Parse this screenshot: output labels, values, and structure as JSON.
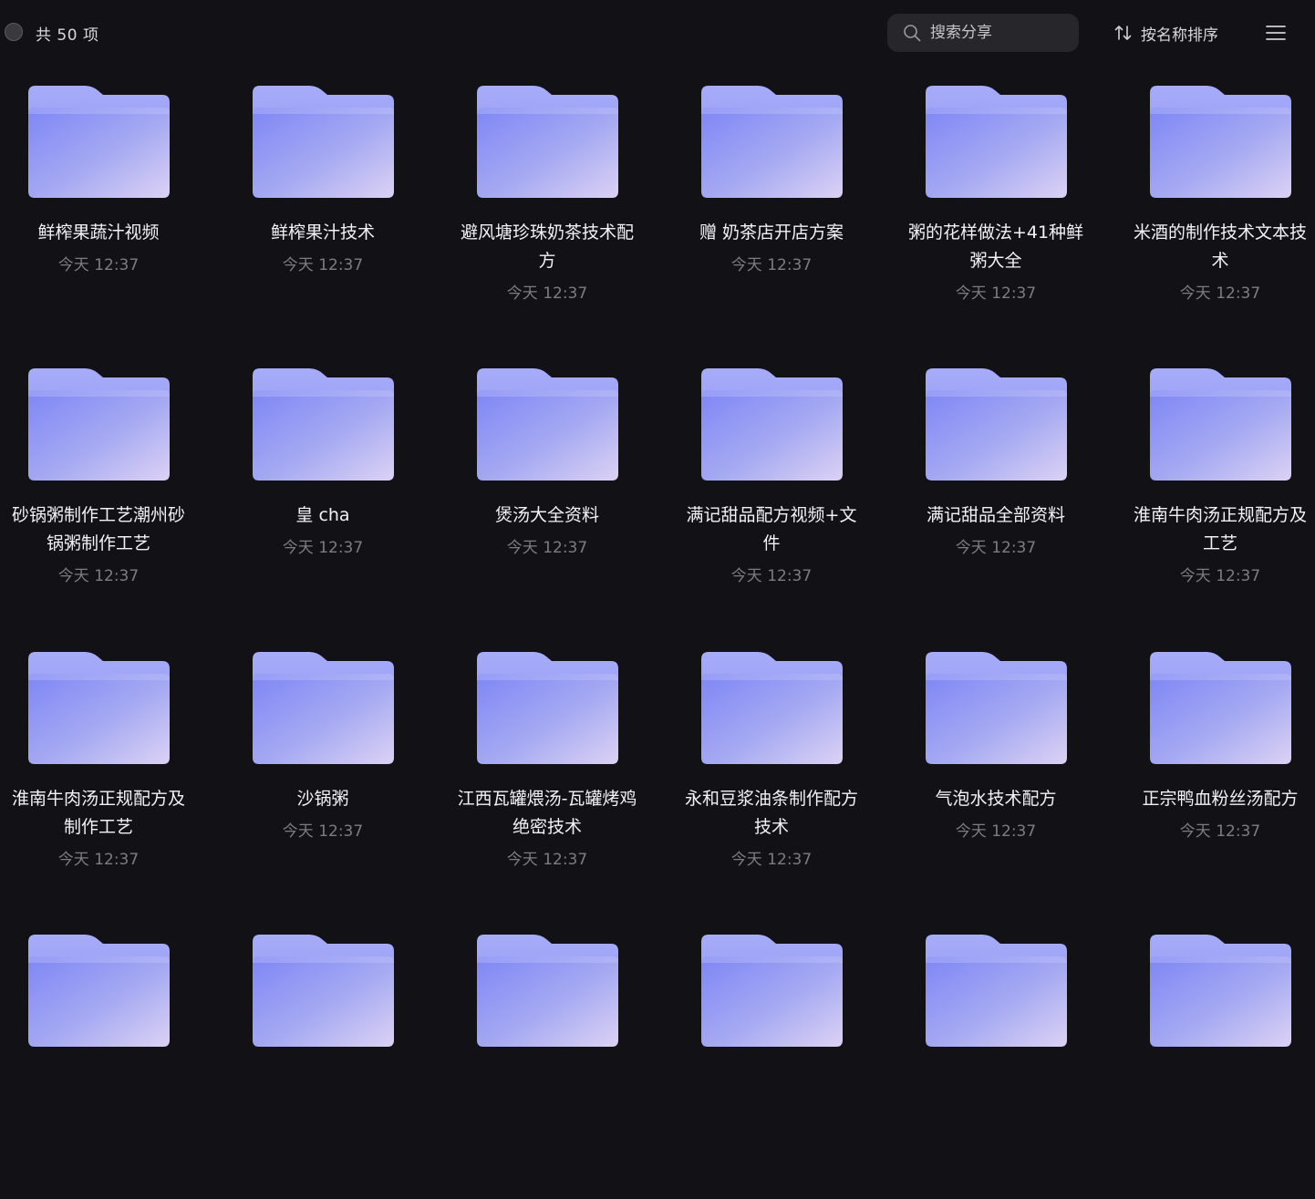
{
  "toolbar": {
    "count_label": "共 50 项",
    "search_placeholder": "搜索分享",
    "sort_label": "按名称排序"
  },
  "folders": [
    {
      "name": "鲜榨果蔬汁视频",
      "time": "今天 12:37"
    },
    {
      "name": "鲜榨果汁技术",
      "time": "今天 12:37"
    },
    {
      "name": "避风塘珍珠奶茶技术配方",
      "time": "今天 12:37"
    },
    {
      "name": "赠 奶茶店开店方案",
      "time": "今天 12:37"
    },
    {
      "name": "粥的花样做法+41种鲜粥大全",
      "time": "今天 12:37"
    },
    {
      "name": "米酒的制作技术文本技术",
      "time": "今天 12:37"
    },
    {
      "name": "砂锅粥制作工艺潮州砂锅粥制作工艺",
      "time": "今天 12:37"
    },
    {
      "name": "皇 cha",
      "time": "今天 12:37"
    },
    {
      "name": "煲汤大全资料",
      "time": "今天 12:37"
    },
    {
      "name": "满记甜品配方视频+文件",
      "time": "今天 12:37"
    },
    {
      "name": "满记甜品全部资料",
      "time": "今天 12:37"
    },
    {
      "name": "淮南牛肉汤正规配方及工艺",
      "time": "今天 12:37"
    },
    {
      "name": "淮南牛肉汤正规配方及制作工艺",
      "time": "今天 12:37"
    },
    {
      "name": "沙锅粥",
      "time": "今天 12:37"
    },
    {
      "name": "江西瓦罐煨汤-瓦罐烤鸡绝密技术",
      "time": "今天 12:37"
    },
    {
      "name": "永和豆浆油条制作配方技术",
      "time": "今天 12:37"
    },
    {
      "name": "气泡水技术配方",
      "time": "今天 12:37"
    },
    {
      "name": "正宗鸭血粉丝汤配方",
      "time": "今天 12:37"
    },
    {
      "name": "",
      "time": ""
    },
    {
      "name": "",
      "time": ""
    },
    {
      "name": "",
      "time": ""
    },
    {
      "name": "",
      "time": ""
    },
    {
      "name": "",
      "time": ""
    },
    {
      "name": "",
      "time": ""
    }
  ],
  "colors": {
    "background": "#121216",
    "folder_top": "#8e96f6",
    "folder_bottom": "#d4ccf2",
    "folder_accent": "#7d85f2"
  }
}
